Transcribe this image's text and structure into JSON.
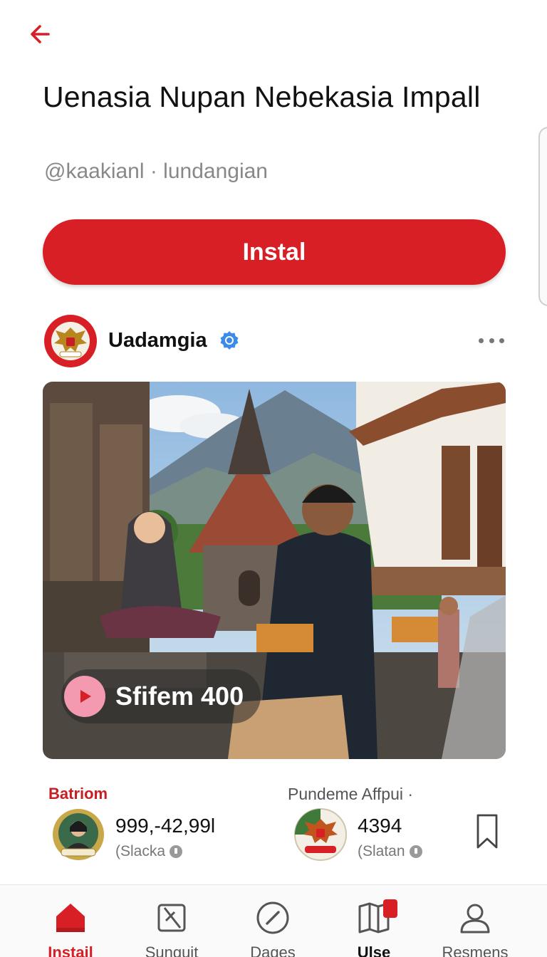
{
  "header": {
    "back_icon": "arrow-left-icon",
    "title": "Uenasia Nupan Nebekasia Impall",
    "handle": "@kaakianl · lundangian",
    "install_label": "Instal"
  },
  "post": {
    "author": "Uadamgia",
    "verified_icon": "verified-badge-icon",
    "more_icon": "more-horizontal-icon",
    "media_label": "Sfifem 400",
    "play_icon": "play-icon"
  },
  "stats": {
    "left": {
      "heading": "Batriom",
      "value": "999,-42,99l",
      "sub": "(Slacka"
    },
    "right": {
      "heading": "Pundeme Affpui ·",
      "value": "4394",
      "sub": "(Slatan"
    },
    "bookmark_icon": "bookmark-icon"
  },
  "tabbar": {
    "tabs": [
      {
        "label": "Instail",
        "icon": "home-icon"
      },
      {
        "label": "Sunguit",
        "icon": "crop-icon"
      },
      {
        "label": "Dages",
        "icon": "compass-icon"
      },
      {
        "label": "Ulse",
        "icon": "book-icon"
      },
      {
        "label": "Resmens",
        "icon": "profile-icon"
      }
    ]
  },
  "colors": {
    "accent": "#d71f25",
    "play_pill": "#f39ab0",
    "muted_text": "#888888"
  }
}
